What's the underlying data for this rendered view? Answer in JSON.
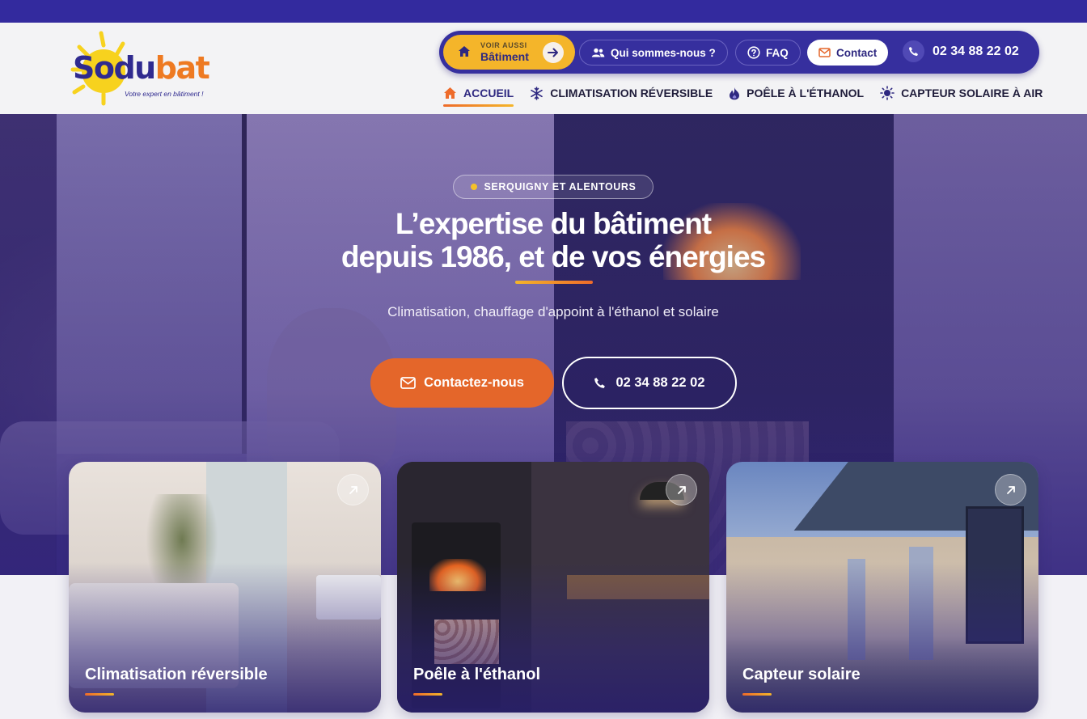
{
  "brand": {
    "name_part1": "So",
    "name_part2": "du",
    "name_part3": "bat",
    "tagline": "Votre expert en bâtiment !"
  },
  "topbar": {
    "voir_aussi_label": "VOIR AUSSI",
    "voir_aussi_target": "Bâtiment",
    "about_label": "Qui sommes-nous ?",
    "faq_label": "FAQ",
    "contact_label": "Contact",
    "phone": "02 34 88 22 02"
  },
  "nav": {
    "items": [
      {
        "label": "ACCUEIL",
        "icon": "home-icon",
        "active": true
      },
      {
        "label": "CLIMATISATION RÉVERSIBLE",
        "icon": "snowflake-icon",
        "active": false
      },
      {
        "label": "POÊLE À L'ÉTHANOL",
        "icon": "flame-icon",
        "active": false
      },
      {
        "label": "CAPTEUR SOLAIRE À AIR",
        "icon": "sun-icon",
        "active": false
      }
    ]
  },
  "hero": {
    "location_chip": "SERQUIGNY ET ALENTOURS",
    "title_line1": "L’expertise du bâtiment",
    "title_line2": "depuis 1986, et de vos énergies",
    "subtitle": "Climatisation, chauffage d'appoint à l'éthanol et solaire",
    "cta_contact": "Contactez-nous",
    "cta_phone": "02 34 88 22 02"
  },
  "cards": [
    {
      "title": "Climatisation réversible"
    },
    {
      "title": "Poêle à l'éthanol"
    },
    {
      "title": "Capteur solaire"
    }
  ],
  "colors": {
    "primary": "#332a9e",
    "accent_orange": "#e4662a",
    "accent_yellow": "#f4b52a"
  }
}
